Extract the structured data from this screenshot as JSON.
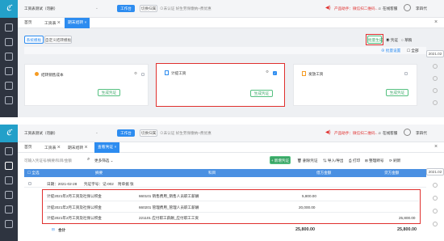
{
  "colors": {
    "accent": "#2d8cf0",
    "highlight": "#e0302e",
    "sidebar": "#2e3440",
    "success": "#3aa667"
  },
  "panel1": {
    "top": {
      "company": "工资表测试（勿删）",
      "period_button": "工作台",
      "switch_button": "切换归属",
      "not_certified": "未认证",
      "tax_status": "好生劳保缴纳+费优惠",
      "notice": "产品助手：微信扫二维码…",
      "online_service": "在线客服",
      "user": "李四代"
    },
    "tabs": [
      "首页",
      "工资表",
      "期末结转"
    ],
    "subtabs": [
      "系统模板",
      "自定义结转模板"
    ],
    "toolbar": {
      "generate_all": "批量生成",
      "voucher_radio": "凭证",
      "draft_radio": "草稿"
    },
    "filter": {
      "batch_setting": "批量设置",
      "all": "全部"
    },
    "date_chip": "2021.02",
    "cards": [
      {
        "title": "结转销售成本",
        "button": "生成凭证"
      },
      {
        "title": "计提工资",
        "button": "生成凭证"
      },
      {
        "title": "发放工资",
        "button": "生成凭证"
      }
    ]
  },
  "panel2": {
    "top": {
      "company": "工资表测试（勿删）",
      "period_button": "工作台",
      "switch_button": "切换归属",
      "not_certified": "未认证",
      "tax_status": "好生劳保缴纳+费优惠",
      "notice": "产品助手：微信扫二维码…",
      "online_service": "在线客服",
      "user": "李四代"
    },
    "tabs": [
      "首页",
      "工资表",
      "期末结转",
      "查看凭证"
    ],
    "search_placeholder": "可输入凭证号/摘要/科目/金额",
    "more_filter": "更多筛选",
    "actions": [
      "+ 新增凭证",
      "删除凭证",
      "导入/导出",
      "打印",
      "整理断号",
      "刷新"
    ],
    "date_chip": "2021.02",
    "columns": {
      "select_all": "全选",
      "summary": "摘要",
      "subject": "科目",
      "debit": "借方金额",
      "credit": "贷方金额"
    },
    "voucher_meta": {
      "date": "日期：2021-02-28",
      "number": "凭证字号：记-002",
      "attachments": "附单据 张"
    },
    "rows": [
      {
        "summary": "计提2021年2月工资及社保公积金",
        "subject": "660101 销售费用_销售人员职工薪酬",
        "debit": "5,800.00",
        "credit": ""
      },
      {
        "summary": "计提2021年2月工资及社保公积金",
        "subject": "660201 管理费用_管理人员职工薪酬",
        "debit": "20,000.00",
        "credit": ""
      },
      {
        "summary": "计提2021年2月工资及社保公积金",
        "subject": "221101 应付职工薪酬_应付职工工资",
        "debit": "",
        "credit": "25,800.00"
      }
    ],
    "total": {
      "label": "合计",
      "debit": "25,800.00",
      "credit": "25,800.00"
    }
  }
}
